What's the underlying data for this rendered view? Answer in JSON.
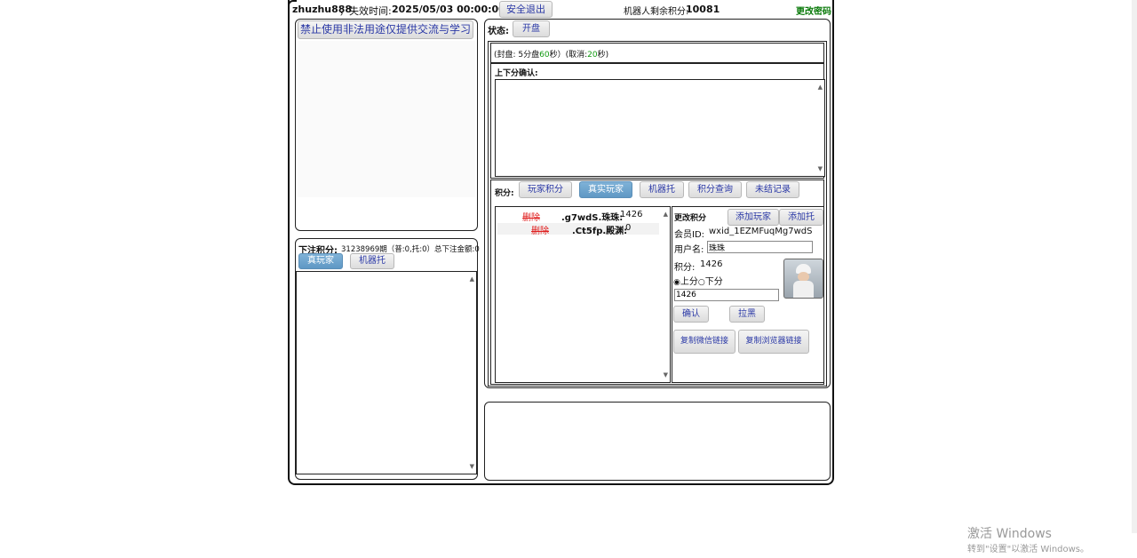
{
  "header": {
    "username": "zhuzhu888",
    "expire_label": "，失效时间:",
    "expire_value": "2025/05/03 00:00:00",
    "logout_button": "安全退出",
    "robot_points_label": "机器人剩余积分:",
    "robot_points_value": "10081",
    "change_password": "更改密码"
  },
  "left_top": {
    "notice_button": "禁止使用非法用途仅提供交流与学习"
  },
  "left_bottom": {
    "bet_points_label": "下注积分:",
    "bet_info": "31238969期（普:0,托:0）总下注金额:0",
    "tabs": [
      "真玩家",
      "机器托"
    ]
  },
  "status": {
    "label": "状态:",
    "button": "开盘"
  },
  "sealing": {
    "prefix": "(封盘:  5分盘",
    "seconds": "60",
    "middle": "秒）(取消:",
    "cancel": "20",
    "suffix": "秒)"
  },
  "confirm": {
    "label": "上下分确认:"
  },
  "points_bar": {
    "label": "积分:",
    "tabs": [
      "玩家积分",
      "真实玩家",
      "机器托",
      "积分查询",
      "未结记录"
    ],
    "active_index": 1
  },
  "player_list": [
    {
      "action": "删除",
      "name": ".g7wdS.珠珠:",
      "points": "1426"
    },
    {
      "action": "删除",
      "name": ".Ct5fp.殿渊:",
      "points": "0"
    }
  ],
  "edit": {
    "title": "更改积分",
    "add_player": "添加玩家",
    "add_bot": "添加托",
    "member_id_label": "会员ID:",
    "member_id_value": "wxid_1EZMFuqMg7wdS",
    "username_label": "用户名:",
    "username_value": "珠珠",
    "points_label": "积分:",
    "points_value": "1426",
    "radio_up": "上分",
    "radio_down": "下分",
    "amount_value": "1426",
    "confirm_button": "确认",
    "block_button": "拉黑",
    "copy_wechat": "复制微信链接",
    "copy_browser": "复制浏览器链接"
  },
  "watermark": {
    "line1": "激活 Windows",
    "line2": "转到\"设置\"以激活 Windows。"
  }
}
